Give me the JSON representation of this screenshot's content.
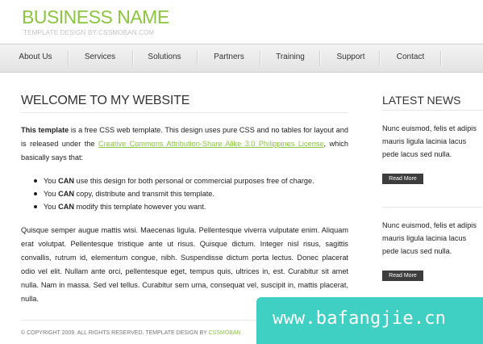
{
  "header": {
    "brand": "BUSINESS NAME",
    "tagline": "TEMPLATE DESIGN BY CSSMOBAN.COM"
  },
  "nav": {
    "items": [
      "About Us",
      "Services",
      "Solutions",
      "Partners",
      "Training",
      "Support",
      "Contact"
    ]
  },
  "main": {
    "title": "WELCOME TO MY WEBSITE",
    "intro": {
      "strong": "This template",
      "text1": " is a free CSS web template. This design uses pure CSS and no tables for layout and is released under the ",
      "link": "Creative Commons Attribution-Share Alike 3.0 Philippines License",
      "text2": ", which basically says that:"
    },
    "list": [
      {
        "a": "You ",
        "b": "CAN",
        "c": " use this design for both personal or commercial purposes free of charge."
      },
      {
        "a": "You ",
        "b": "CAN",
        "c": " copy, distribute and transmit this template."
      },
      {
        "a": "You ",
        "b": "CAN",
        "c": " modify this template however you want."
      }
    ],
    "lorem": "Quisque semper augue mattis wisi. Maecenas ligula. Pellentesque viverra vulputate enim. Aliquam erat volutpat. Pellentesque tristique ante ut risus. Quisque dictum. Integer nisl risus, sagittis convallis, rutrum id, elementum congue, nibh. Suspendisse dictum porta lectus. Donec placerat odio vel elit. Nullam ante orci, pellentesque eget, tempus quis, ultrices in, est. Curabitur sit amet nulla. Nam in massa. Sed vel tellus. Curabitur sem urna, consequat vel, suscipit in, mattis placerat, nulla."
  },
  "sidebar": {
    "title": "LATEST NEWS",
    "news": [
      {
        "line1": "Nunc euismod, felis et adipis",
        "line2": "mauris ligula lacinia lacus",
        "line3": "pede lacus sed nulla.",
        "button": "Read More"
      },
      {
        "line1": "Nunc euismod, felis et adipis",
        "line2": "mauris ligula lacinia lacus",
        "line3": "pede lacus sed nulla.",
        "button": "Read More"
      }
    ]
  },
  "footer": {
    "text": "© COPYRIGHT 2009. ALL RIGHTS RESERVED. TEMPLATE DESIGN BY ",
    "link": "CSSMOBAN"
  },
  "watermark": "www.bafangjie.cn",
  "colors": {
    "accent": "#8cc63f",
    "watermark": "#3fd0c3",
    "button": "#3d3d3d"
  }
}
